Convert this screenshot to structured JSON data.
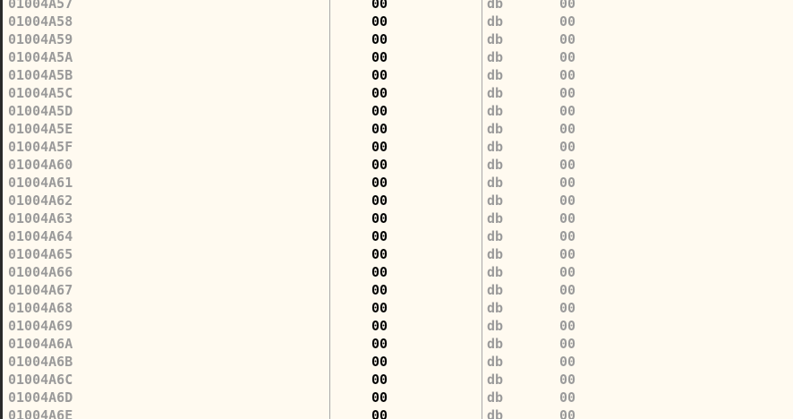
{
  "theme": {
    "background": "#fffaf0",
    "address_color": "#9a9a9a",
    "bytes_color": "#000000",
    "mnemonic_color": "#9a9a9a",
    "separator_color": "#a8a8a8"
  },
  "disassembly": {
    "rows": [
      {
        "address": "01004A57",
        "bytes": "00",
        "mnemonic": "db",
        "operand": "00"
      },
      {
        "address": "01004A58",
        "bytes": "00",
        "mnemonic": "db",
        "operand": "00"
      },
      {
        "address": "01004A59",
        "bytes": "00",
        "mnemonic": "db",
        "operand": "00"
      },
      {
        "address": "01004A5A",
        "bytes": "00",
        "mnemonic": "db",
        "operand": "00"
      },
      {
        "address": "01004A5B",
        "bytes": "00",
        "mnemonic": "db",
        "operand": "00"
      },
      {
        "address": "01004A5C",
        "bytes": "00",
        "mnemonic": "db",
        "operand": "00"
      },
      {
        "address": "01004A5D",
        "bytes": "00",
        "mnemonic": "db",
        "operand": "00"
      },
      {
        "address": "01004A5E",
        "bytes": "00",
        "mnemonic": "db",
        "operand": "00"
      },
      {
        "address": "01004A5F",
        "bytes": "00",
        "mnemonic": "db",
        "operand": "00"
      },
      {
        "address": "01004A60",
        "bytes": "00",
        "mnemonic": "db",
        "operand": "00"
      },
      {
        "address": "01004A61",
        "bytes": "00",
        "mnemonic": "db",
        "operand": "00"
      },
      {
        "address": "01004A62",
        "bytes": "00",
        "mnemonic": "db",
        "operand": "00"
      },
      {
        "address": "01004A63",
        "bytes": "00",
        "mnemonic": "db",
        "operand": "00"
      },
      {
        "address": "01004A64",
        "bytes": "00",
        "mnemonic": "db",
        "operand": "00"
      },
      {
        "address": "01004A65",
        "bytes": "00",
        "mnemonic": "db",
        "operand": "00"
      },
      {
        "address": "01004A66",
        "bytes": "00",
        "mnemonic": "db",
        "operand": "00"
      },
      {
        "address": "01004A67",
        "bytes": "00",
        "mnemonic": "db",
        "operand": "00"
      },
      {
        "address": "01004A68",
        "bytes": "00",
        "mnemonic": "db",
        "operand": "00"
      },
      {
        "address": "01004A69",
        "bytes": "00",
        "mnemonic": "db",
        "operand": "00"
      },
      {
        "address": "01004A6A",
        "bytes": "00",
        "mnemonic": "db",
        "operand": "00"
      },
      {
        "address": "01004A6B",
        "bytes": "00",
        "mnemonic": "db",
        "operand": "00"
      },
      {
        "address": "01004A6C",
        "bytes": "00",
        "mnemonic": "db",
        "operand": "00"
      },
      {
        "address": "01004A6D",
        "bytes": "00",
        "mnemonic": "db",
        "operand": "00"
      },
      {
        "address": "01004A6E",
        "bytes": "00",
        "mnemonic": "db",
        "operand": "00"
      }
    ]
  }
}
